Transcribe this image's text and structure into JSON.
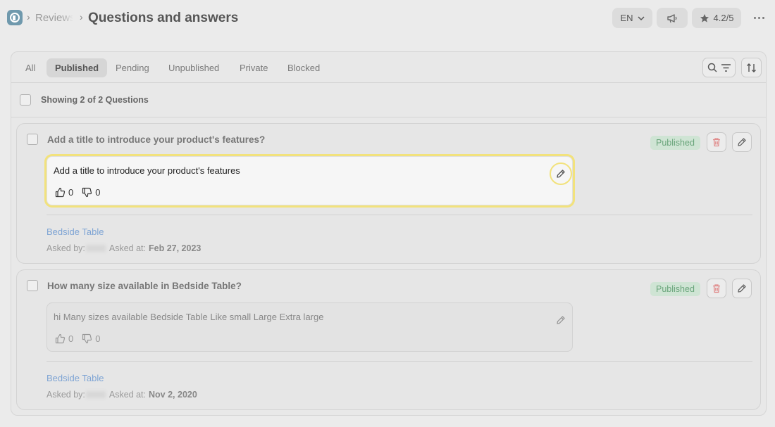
{
  "header": {
    "breadcrumb_prev": "Reviews",
    "breadcrumb_sep": "›",
    "page_title": "Questions and answers",
    "language": "EN",
    "rating": "4.2/5"
  },
  "tabs": [
    {
      "label": "All",
      "active": false
    },
    {
      "label": "Published",
      "active": true
    },
    {
      "label": "Pending",
      "active": false
    },
    {
      "label": "Unpublished",
      "active": false
    },
    {
      "label": "Private",
      "active": false
    },
    {
      "label": "Blocked",
      "active": false
    }
  ],
  "count_text": "Showing 2 of 2 Questions",
  "questions": [
    {
      "title": "Add a title to introduce your product's features?",
      "status": "Published",
      "answer": "Add a title to introduce your product's features",
      "likes": "0",
      "dislikes": "0",
      "product": "Bedside Table",
      "asked_by_label": "Asked by:",
      "asked_at_label": "Asked at:",
      "asked_at": "Feb 27, 2023"
    },
    {
      "title": "How many size available in Bedside Table?",
      "status": "Published",
      "answer": "hi Many sizes available Bedside Table Like small Large Extra large",
      "likes": "0",
      "dislikes": "0",
      "product": "Bedside Table",
      "asked_by_label": "Asked by:",
      "asked_at_label": "Asked at:",
      "asked_at": "Nov 2, 2020"
    }
  ],
  "colors": {
    "accent_highlight": "#f2e27c",
    "published_badge_bg": "#cfe4d4",
    "published_badge_text": "#6aa57b",
    "delete_icon": "#e08a8a",
    "link": "#7ea4d4"
  }
}
